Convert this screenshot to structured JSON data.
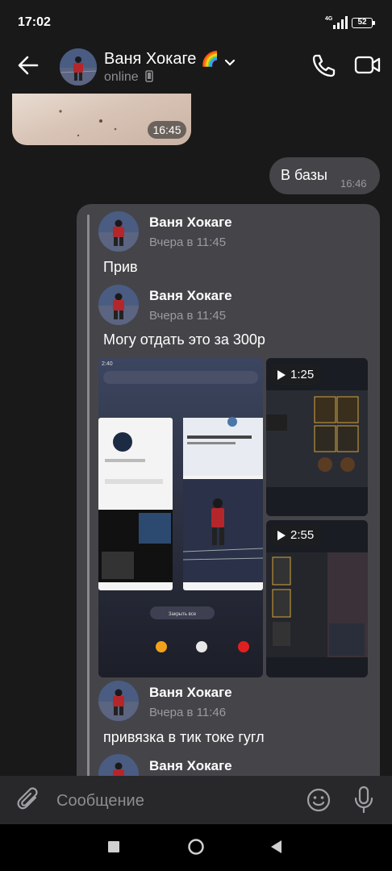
{
  "status_bar": {
    "time": "17:02",
    "network": "4G",
    "battery": "52"
  },
  "header": {
    "name": "Ваня Хокаге",
    "name_emoji": "🌈",
    "status": "online",
    "icons": [
      "back-arrow-icon",
      "chevron-down-icon",
      "phone-icon",
      "video-call-icon"
    ]
  },
  "messages": {
    "photo_time": "16:45",
    "outgoing": {
      "text": "В базы",
      "time": "16:46"
    },
    "forwarded": [
      {
        "sender": "Ваня Хокаге",
        "time": "Вчера в 11:45",
        "text": "Прив"
      },
      {
        "sender": "Ваня Хокаге",
        "time": "Вчера в 11:45",
        "text": "Могу отдать это за 300р"
      },
      {
        "sender": "Ваня Хокаге",
        "time": "Вчера в 11:46",
        "text": "привязка в тик токе гугл"
      },
      {
        "sender": "Ваня Хокаге",
        "time": "",
        "text": ""
      }
    ],
    "videos": [
      {
        "duration": "1:25"
      },
      {
        "duration": "2:55"
      }
    ],
    "screenshot": {
      "time": "2:40",
      "button": "Закрыть все"
    }
  },
  "composer": {
    "placeholder": "Сообщение",
    "icons": [
      "attach-icon",
      "emoji-icon",
      "mic-icon"
    ]
  },
  "colors": {
    "background": "#19191a",
    "bubble": "#454549",
    "meta": "#9a9aa0"
  }
}
